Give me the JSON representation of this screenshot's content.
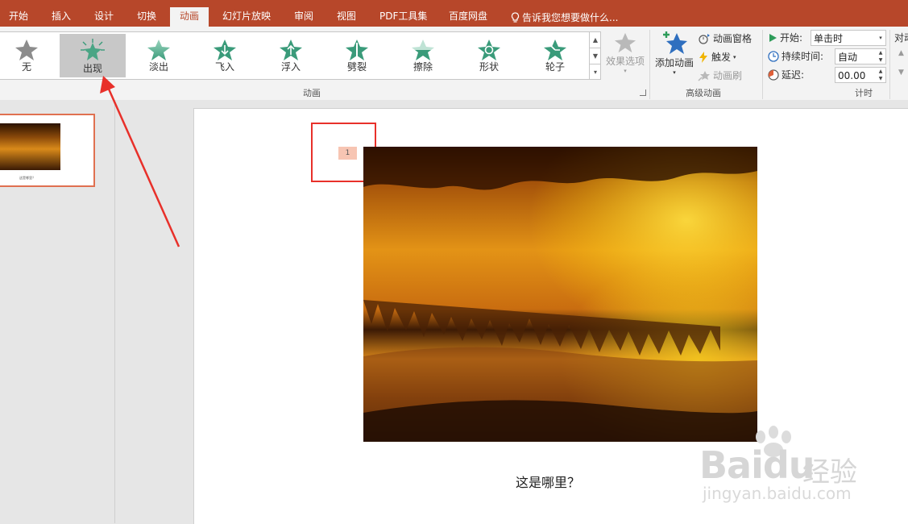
{
  "ribbon_tabs": [
    "开始",
    "插入",
    "设计",
    "切换",
    "动画",
    "幻灯片放映",
    "审阅",
    "视图",
    "PDF工具集",
    "百度网盘"
  ],
  "active_tab": "动画",
  "tell_me": "告诉我您想要做什么...",
  "animations": [
    {
      "label": "无",
      "icon": "star-gray-icon",
      "selected": false
    },
    {
      "label": "出现",
      "icon": "star-burst-icon",
      "selected": true
    },
    {
      "label": "淡出",
      "icon": "star-fade-icon",
      "selected": false
    },
    {
      "label": "飞入",
      "icon": "star-fly-in-icon",
      "selected": false
    },
    {
      "label": "浮入",
      "icon": "star-float-in-icon",
      "selected": false
    },
    {
      "label": "劈裂",
      "icon": "star-split-icon",
      "selected": false
    },
    {
      "label": "擦除",
      "icon": "star-wipe-icon",
      "selected": false
    },
    {
      "label": "形状",
      "icon": "star-shape-icon",
      "selected": false
    },
    {
      "label": "轮子",
      "icon": "star-wheel-icon",
      "selected": false
    }
  ],
  "effect_options": "效果选项",
  "group_animation": "动画",
  "advanced": {
    "add_animation": "添加动画",
    "animation_pane": "动画窗格",
    "trigger": "触发",
    "animation_painter": "动画刷",
    "group_label": "高级动画"
  },
  "timing": {
    "start_label": "开始:",
    "start_value": "单击时",
    "duration_label": "持续时间:",
    "duration_value": "自动",
    "delay_label": "延迟:",
    "delay_value": "00.00",
    "group_label": "计时",
    "reorder_label": "对动"
  },
  "slide": {
    "animation_marker": "1",
    "caption": "这是哪里？"
  },
  "watermark": {
    "brand": "Baidu",
    "brand_cn": "经验",
    "url": "jingyan.baidu.com"
  },
  "colors": {
    "accent": "#b7472a",
    "highlight_box": "#e8302a",
    "marker": "#f7c5b3"
  }
}
